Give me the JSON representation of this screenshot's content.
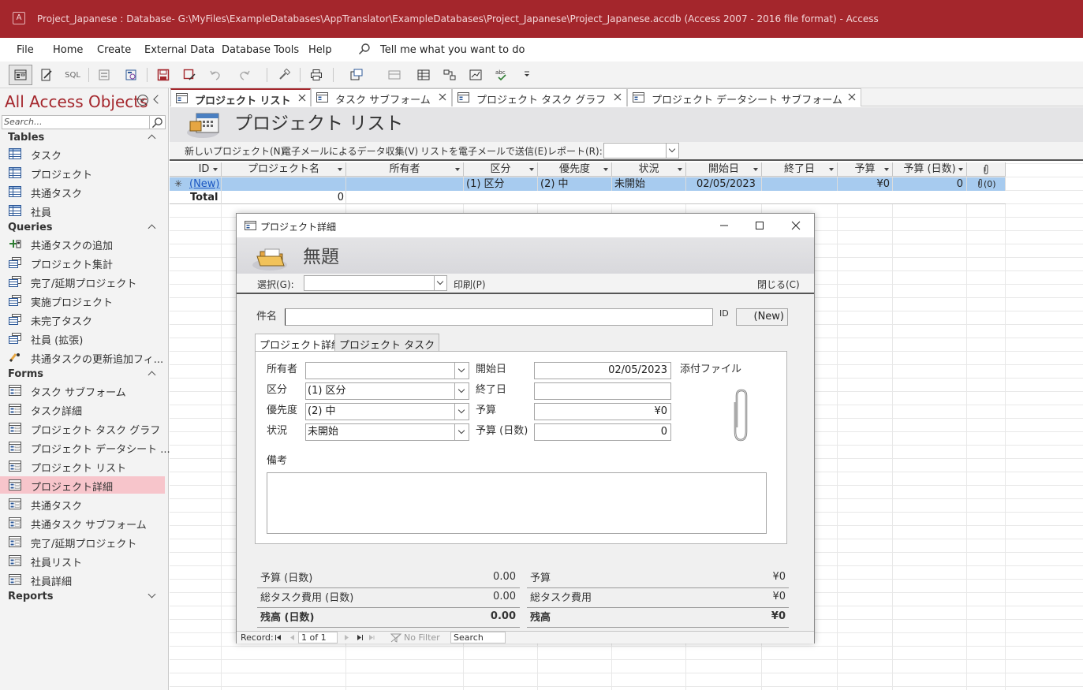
{
  "titlebar": {
    "title": "Project_Japanese : Database- G:\\MyFiles\\ExampleDatabases\\AppTranslator\\ExampleDatabases\\Project_Japanese\\Project_Japanese.accdb (Access 2007 - 2016 file format)  -  Access",
    "app_icon": "access-logo-icon"
  },
  "menu": {
    "items": [
      "File",
      "Home",
      "Create",
      "External Data",
      "Database Tools",
      "Help"
    ],
    "tell_me": "Tell me what you want to do"
  },
  "toolbar": {
    "sql_label": "SQL"
  },
  "nav": {
    "title": "All Access Objects",
    "search_placeholder": "Search...",
    "sections": {
      "tables": "Tables",
      "queries": "Queries",
      "forms": "Forms",
      "reports": "Reports"
    },
    "tables": [
      "タスク",
      "プロジェクト",
      "共通タスク",
      "社員"
    ],
    "queries": [
      "共通タスクの追加",
      "プロジェクト集計",
      "完了/延期プロジェクト",
      "実施プロジェクト",
      "未完了タスク",
      "社員 (拡張)",
      "共通タスクの更新追加フィ..."
    ],
    "forms": [
      "タスク サブフォーム",
      "タスク詳細",
      "プロジェクト タスク グラフ",
      "プロジェクト データシート ...",
      "プロジェクト リスト",
      "プロジェクト詳細",
      "共通タスク",
      "共通タスク サブフォーム",
      "完了/延期プロジェクト",
      "社員リスト",
      "社員詳細"
    ],
    "selected_form": "プロジェクト詳細"
  },
  "doctabs": [
    "プロジェクト リスト",
    "タスク サブフォーム",
    "プロジェクト タスク グラフ",
    "プロジェクト データシート サブフォーム"
  ],
  "listform": {
    "title": "プロジェクト リスト",
    "actions": [
      "新しいプロジェクト(N)",
      "電子メールによるデータ収集(V)",
      "リストを電子メールで送信(E)",
      "レポート(R):"
    ],
    "report_value": ""
  },
  "grid": {
    "columns": [
      "ID",
      "プロジェクト名",
      "所有者",
      "区分",
      "優先度",
      "状況",
      "開始日",
      "終了日",
      "予算",
      "予算 (日数)"
    ],
    "new_row": {
      "selector": "✳",
      "id": "(New)",
      "owner": "",
      "category": "(1) 区分",
      "priority": "(2) 中",
      "status": "未開始",
      "start": "02/05/2023",
      "end": "",
      "budget": "¥0",
      "budget_days": "0",
      "attach": "(0)"
    },
    "total_row": {
      "label": "Total",
      "count": "0"
    }
  },
  "popup": {
    "window_title": "プロジェクト詳細",
    "header_title": "無題",
    "select_label": "選択(G):",
    "print_label": "印刷(P)",
    "close_label": "閉じる(C)",
    "subject_label": "件名",
    "subject_value": "",
    "id_label": "ID",
    "id_value": "(New)",
    "tabs": [
      "プロジェクト詳細",
      "プロジェクト タスク"
    ],
    "fields": {
      "owner_label": "所有者",
      "owner_value": "",
      "category_label": "区分",
      "category_value": "(1) 区分",
      "priority_label": "優先度",
      "priority_value": "(2) 中",
      "status_label": "状況",
      "status_value": "未開始",
      "start_label": "開始日",
      "start_value": "02/05/2023",
      "end_label": "終了日",
      "end_value": "",
      "budget_label": "予算",
      "budget_value": "¥0",
      "budget_days_label": "予算 (日数)",
      "budget_days_value": "0",
      "attach_label": "添付ファイル",
      "remarks_label": "備考",
      "remarks_value": ""
    },
    "summary": {
      "left": [
        {
          "label": "予算 (日数)",
          "value": "0.00"
        },
        {
          "label": "総タスク費用 (日数)",
          "value": "0.00"
        },
        {
          "label": "残高 (日数)",
          "value": "0.00"
        }
      ],
      "right": [
        {
          "label": "予算",
          "value": "¥0"
        },
        {
          "label": "総タスク費用",
          "value": "¥0"
        },
        {
          "label": "残高",
          "value": "¥0"
        }
      ]
    },
    "record_nav": {
      "record_label": "Record:",
      "position": "1 of 1",
      "filter": "No Filter",
      "search": "Search"
    }
  }
}
